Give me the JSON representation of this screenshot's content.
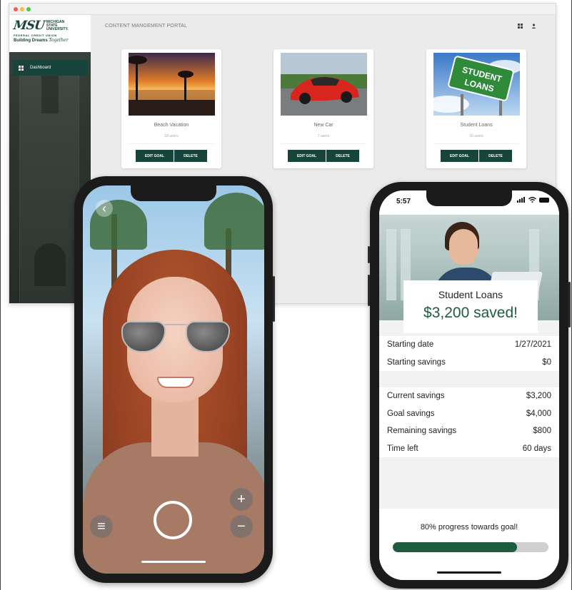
{
  "desktop": {
    "logo": {
      "wordmark": "MSU",
      "name_lines": [
        "MICHIGAN",
        "STATE",
        "UNIVERSITY."
      ],
      "fcu": "FEDERAL CREDIT UNION",
      "tagline": "Building Dreams",
      "tagline_script": "Together"
    },
    "nav": {
      "dashboard_label": "Dashboard"
    },
    "header": {
      "title": "CONTENT MANGEMENT PORTAL",
      "grid_icon": "grid-view-icon",
      "user_icon": "user-icon"
    },
    "cards": [
      {
        "title": "Beach Vacation",
        "users": "18 users",
        "edit_label": "EDIT GOAL",
        "delete_label": "DELETE",
        "image": "beach-sunset"
      },
      {
        "title": "New Car",
        "users": "7 users",
        "edit_label": "EDIT GOAL",
        "delete_label": "DELETE",
        "image": "red-sports-car"
      },
      {
        "title": "Student Loans",
        "users": "10 users",
        "edit_label": "EDIT GOAL",
        "delete_label": "DELETE",
        "image": "student-loans-sign"
      }
    ],
    "sign_text": [
      "STUDENT",
      "LOANS"
    ]
  },
  "camera_phone": {
    "back_icon": "chevron-left-icon",
    "back_glyph": "‹",
    "menu_icon": "hamburger-menu-icon",
    "menu_glyph": "≡",
    "zoom_in_glyph": "+",
    "zoom_out_glyph": "−"
  },
  "goal_phone": {
    "status_time": "5:57",
    "goal_name": "Student Loans",
    "saved_text": "$3,200 saved!",
    "section1": [
      {
        "label": "Starting date",
        "value": "1/27/2021"
      },
      {
        "label": "Starting savings",
        "value": "$0"
      }
    ],
    "section2": [
      {
        "label": "Current savings",
        "value": "$3,200"
      },
      {
        "label": "Goal savings",
        "value": "$4,000"
      },
      {
        "label": "Remaining savings",
        "value": "$800"
      },
      {
        "label": "Time left",
        "value": "60 days"
      }
    ],
    "progress_text": "80% progress towards goal!",
    "progress_fraction": 0.8
  },
  "colors": {
    "brand_green": "#18453b",
    "progress_green": "#1e5c40",
    "track_gray": "#cfcfcf"
  }
}
